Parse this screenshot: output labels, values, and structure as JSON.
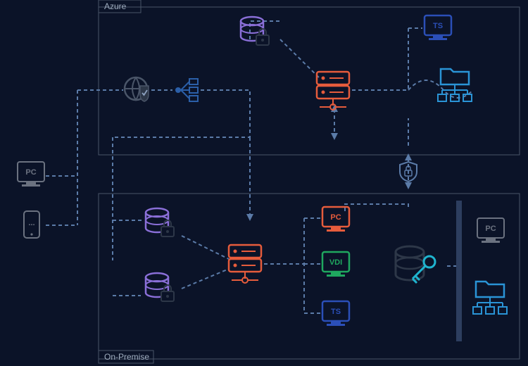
{
  "diagram": {
    "regions": {
      "azure": {
        "title": "Azure"
      },
      "onprem": {
        "title": "On-Premise"
      }
    },
    "external": {
      "pc": {
        "label": "PC",
        "kind": "pc-monitor"
      },
      "mobile": {
        "label": "...",
        "kind": "mobile-phone"
      }
    },
    "azure_nodes": {
      "firewall": {
        "kind": "globe-shield"
      },
      "load_balancer": {
        "kind": "load-balancer"
      },
      "db_secure": {
        "kind": "database-lock"
      },
      "app_server": {
        "kind": "server"
      },
      "ts_client": {
        "label": "TS",
        "kind": "monitor"
      },
      "file_share": {
        "kind": "folder-tree"
      }
    },
    "onprem_nodes": {
      "db_secure_1": {
        "kind": "database-lock"
      },
      "db_secure_2": {
        "kind": "database-lock"
      },
      "app_server": {
        "kind": "server"
      },
      "pc_client": {
        "label": "PC",
        "kind": "monitor"
      },
      "vdi_client": {
        "label": "VDI",
        "kind": "monitor"
      },
      "ts_client": {
        "label": "TS",
        "kind": "monitor"
      },
      "db_key": {
        "kind": "database-key"
      },
      "barrier": {
        "kind": "firewall-bar"
      },
      "ext_pc": {
        "label": "PC",
        "kind": "pc-monitor"
      },
      "ext_share": {
        "kind": "folder-tree"
      }
    },
    "link_secure": {
      "kind": "secure-link"
    }
  },
  "colors": {
    "pc_gray": "#6b7280",
    "globe": "#4a5568",
    "lb": "#2b5fa8",
    "db": "#8a6fd8",
    "server": "#e65c3c",
    "ts": "#2b4fb8",
    "vdi": "#1fa85f",
    "pc_orange": "#e65c3c",
    "share": "#2a94d6",
    "secure": "#5b7ba8",
    "barrier": "#2d3e5f",
    "key": "#1fb4cf"
  }
}
